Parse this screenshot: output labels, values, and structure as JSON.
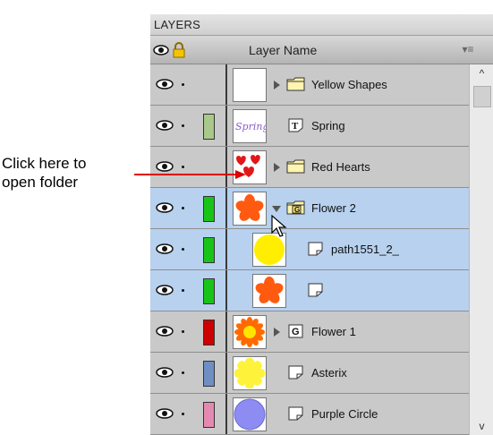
{
  "callout": {
    "line1": "Click here to",
    "line2": "open folder"
  },
  "panel": {
    "title": "LAYERS",
    "column_header": "Layer Name",
    "header_icons": [
      "eye-icon",
      "lock-icon"
    ],
    "menu_icon": "options-menu-icon"
  },
  "layers": [
    {
      "name": "Yellow Shapes",
      "kind": "folder",
      "expander": "closed",
      "swatch": null,
      "thumb": "blank",
      "selected": false
    },
    {
      "name": "Spring",
      "kind": "text",
      "expander": null,
      "swatch": "#a9c98a",
      "thumb": "spring-text",
      "selected": false
    },
    {
      "name": "Red Hearts",
      "kind": "folder",
      "expander": "closed",
      "swatch": null,
      "thumb": "hearts",
      "selected": false
    },
    {
      "name": "Flower 2",
      "kind": "group-folder",
      "expander": "open",
      "swatch": "#19c419",
      "thumb": "orange-flower",
      "selected": true
    },
    {
      "name": "path1551_2_",
      "kind": "path",
      "expander": null,
      "swatch": "#19c419",
      "thumb": "yellow-circle",
      "selected": true
    },
    {
      "name": "",
      "kind": "path",
      "expander": null,
      "swatch": "#19c419",
      "thumb": "orange-flower",
      "selected": true
    },
    {
      "name": "Flower 1",
      "kind": "group",
      "expander": "closed",
      "swatch": "#cc0000",
      "thumb": "sun-flower",
      "selected": false
    },
    {
      "name": "Asterix",
      "kind": "path",
      "expander": null,
      "swatch": "#6f8fc4",
      "thumb": "yellow-asterix",
      "selected": false
    },
    {
      "name": "Purple Circle",
      "kind": "path",
      "expander": null,
      "swatch": "#e48ab0",
      "thumb": "purple-circle",
      "selected": false
    }
  ],
  "thumbnail_text": {
    "spring": "Spring"
  },
  "colors": {
    "selected_row": "#b7d1ef",
    "panel_bg": "#c9c9c9",
    "arrow": "#e00000"
  }
}
